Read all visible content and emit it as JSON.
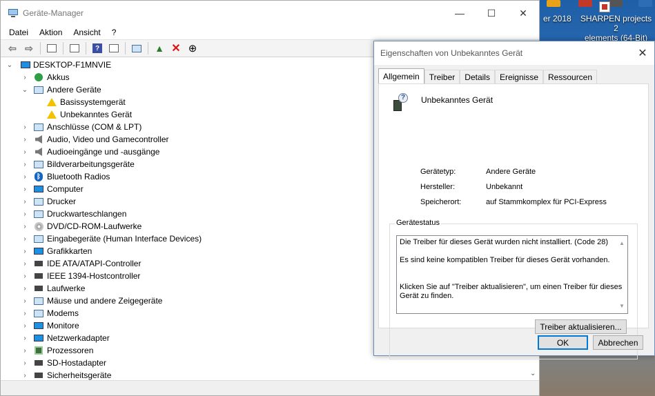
{
  "desktop": {
    "partial_icon_label": "er 2018",
    "sharpen_label_line1": "SHARPEN projects 2",
    "sharpen_label_line2": "elements (64-Bit)"
  },
  "device_manager": {
    "title": "Geräte-Manager",
    "window_controls": {
      "minimize": "—",
      "maximize": "☐",
      "close": "✕"
    },
    "menu": [
      "Datei",
      "Aktion",
      "Ansicht",
      "?"
    ],
    "tree": {
      "root": "DESKTOP-F1MNVIE",
      "items": [
        {
          "label": "Akkus",
          "icon": "battery-icon",
          "expanded": false
        },
        {
          "label": "Andere Geräte",
          "icon": "unknown-device-icon",
          "expanded": true,
          "children": [
            "Basissystemgerät",
            "Unbekanntes Gerät"
          ]
        },
        {
          "label": "Anschlüsse (COM & LPT)",
          "icon": "port-icon",
          "expanded": false
        },
        {
          "label": "Audio, Video und Gamecontroller",
          "icon": "speaker-icon",
          "expanded": false
        },
        {
          "label": "Audioeingänge und -ausgänge",
          "icon": "speaker-icon",
          "expanded": false
        },
        {
          "label": "Bildverarbeitungsgeräte",
          "icon": "camera-icon",
          "expanded": false
        },
        {
          "label": "Bluetooth Radios",
          "icon": "bluetooth-icon",
          "expanded": false
        },
        {
          "label": "Computer",
          "icon": "computer-icon",
          "expanded": false
        },
        {
          "label": "Drucker",
          "icon": "printer-icon",
          "expanded": false
        },
        {
          "label": "Druckwarteschlangen",
          "icon": "printer-icon",
          "expanded": false
        },
        {
          "label": "DVD/CD-ROM-Laufwerke",
          "icon": "disc-icon",
          "expanded": false
        },
        {
          "label": "Eingabegeräte (Human Interface Devices)",
          "icon": "hid-icon",
          "expanded": false
        },
        {
          "label": "Grafikkarten",
          "icon": "display-adapter-icon",
          "expanded": false
        },
        {
          "label": "IDE ATA/ATAPI-Controller",
          "icon": "controller-icon",
          "expanded": false
        },
        {
          "label": "IEEE 1394-Hostcontroller",
          "icon": "firewire-icon",
          "expanded": false
        },
        {
          "label": "Laufwerke",
          "icon": "drive-icon",
          "expanded": false
        },
        {
          "label": "Mäuse und andere Zeigegeräte",
          "icon": "mouse-icon",
          "expanded": false
        },
        {
          "label": "Modems",
          "icon": "modem-icon",
          "expanded": false
        },
        {
          "label": "Monitore",
          "icon": "monitor-icon",
          "expanded": false
        },
        {
          "label": "Netzwerkadapter",
          "icon": "network-icon",
          "expanded": false
        },
        {
          "label": "Prozessoren",
          "icon": "processor-icon",
          "expanded": false
        },
        {
          "label": "SD-Hostadapter",
          "icon": "sd-card-icon",
          "expanded": false
        },
        {
          "label": "Sicherheitsgeräte",
          "icon": "security-icon",
          "expanded": false
        }
      ]
    }
  },
  "dialog": {
    "title": "Eigenschaften von Unbekanntes Gerät",
    "tabs": [
      "Allgemein",
      "Treiber",
      "Details",
      "Ereignisse",
      "Ressourcen"
    ],
    "active_tab": "Allgemein",
    "device_name": "Unbekanntes Gerät",
    "properties": [
      {
        "label": "Gerätetyp:",
        "value": "Andere Geräte"
      },
      {
        "label": "Hersteller:",
        "value": "Unbekannt"
      },
      {
        "label": "Speicherort:",
        "value": "auf Stammkomplex für PCI-Express"
      }
    ],
    "status_group_title": "Gerätestatus",
    "status_lines": [
      "Die Treiber für dieses Gerät wurden nicht installiert. (Code 28)",
      "",
      "Es sind keine kompatiblen Treiber für dieses Gerät vorhanden.",
      "",
      "",
      "Klicken Sie auf \"Treiber aktualisieren\", um einen Treiber für dieses",
      "Gerät zu finden."
    ],
    "update_driver_button": "Treiber aktualisieren...",
    "ok_button": "OK",
    "cancel_button": "Abbrechen"
  }
}
